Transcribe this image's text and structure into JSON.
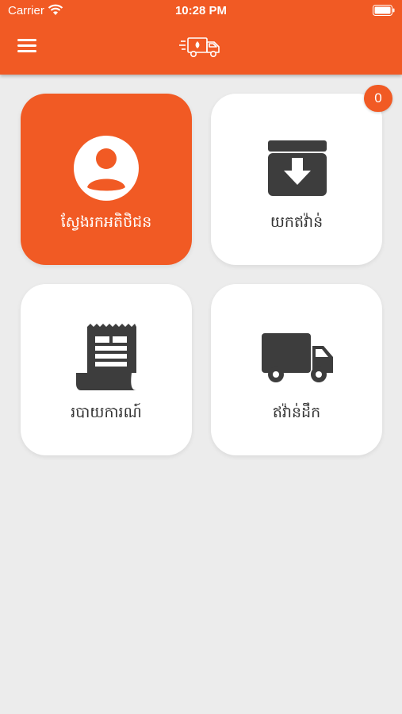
{
  "status_bar": {
    "carrier": "Carrier",
    "time": "10:28 PM"
  },
  "header": {
    "menu_icon": "hamburger-menu-icon",
    "logo_icon": "delivery-truck-logo-icon"
  },
  "colors": {
    "accent": "#f15a24",
    "background": "#ececec",
    "tile": "#ffffff",
    "icon": "#3d3d3d"
  },
  "tiles": [
    {
      "label": "ស្វែងរកអតិថិជន",
      "icon": "user-avatar-icon",
      "active": true
    },
    {
      "label": "យកឥវ៉ាន់",
      "icon": "archive-download-icon",
      "active": false,
      "badge": "0"
    },
    {
      "label": "របាយការណ៍",
      "icon": "receipt-report-icon",
      "active": false
    },
    {
      "label": "ឥវ៉ាន់ដឹក",
      "icon": "delivery-truck-icon",
      "active": false
    }
  ]
}
